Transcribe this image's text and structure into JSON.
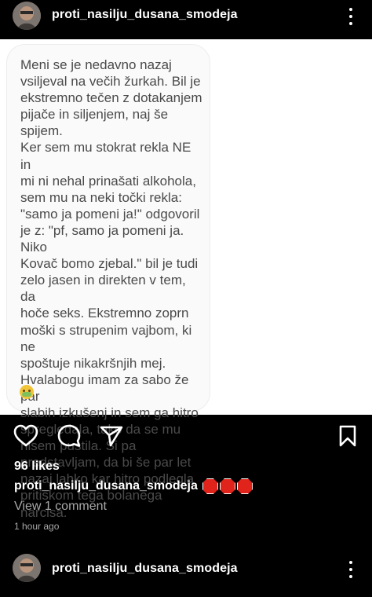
{
  "post": {
    "username": "proti_nasilju_dusana_smodeja",
    "likes": "96 likes",
    "caption_username": "proti_nasilju_dusana_smodeja",
    "view_comments": "View 1 comment",
    "timestamp": "1 hour ago",
    "image_text": "Meni se je nedavno nazaj\nvsiljeval na večih žurkah. Bil je\nekstremno tečen z dotakanjem\npijače in siljenjem, naj še spijem.\nKer sem mu stokrat rekla NE in\nmi ni nehal prinašati alkohola,\nsem mu na neki točki rekla:\n\"samo ja pomeni ja!\" odgovoril\nje z: \"pf, samo ja pomeni ja. Niko\nKovač bomo zjebal.\" bil je tudi\nzelo jasen in direkten v tem, da\nhoče seks. Ekstremno zoprn\nmoški s strupenim vajbom, ki ne\nspoštuje nikakršnjih mej.\nHvalabogu imam za sabo že par\nslabih izkušenj in sem ga hitro\nspregledala, tako da se mu\nnisem pustila. Si pa\npredstavljam, da bi še par let\nnazaj lahko kar hitro podlegla\npritiskom tega bolanega narcisa.",
    "image_emoji": "nauseated-masked-face",
    "caption_emojis": [
      "stop-sign",
      "stop-sign",
      "stop-sign"
    ]
  },
  "next_post": {
    "username": "proti_nasilju_dusana_smodeja"
  },
  "icons": {
    "like": "heart-icon",
    "comment": "comment-icon",
    "share": "send-icon",
    "save": "bookmark-icon",
    "more": "more-options-icon"
  },
  "colors": {
    "background": "#000000",
    "text": "#ffffff",
    "muted": "#a8a8a8",
    "stop_red": "#e0241b"
  }
}
